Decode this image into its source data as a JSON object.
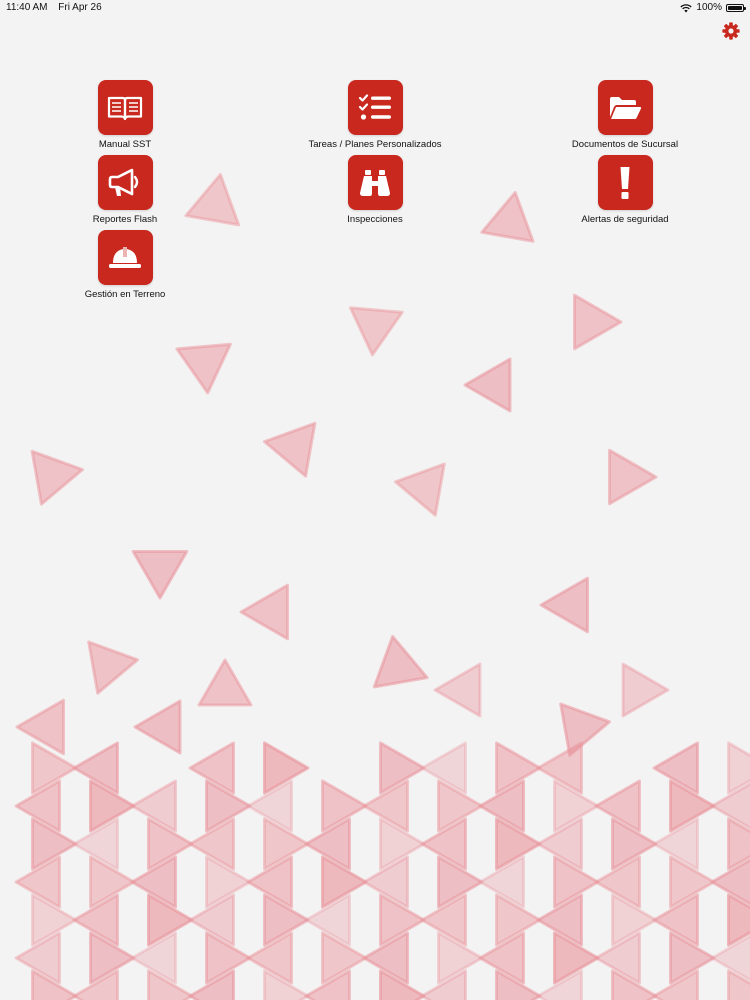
{
  "status_bar": {
    "time": "11:40 AM",
    "date": "Fri Apr 26",
    "battery_text": "100%",
    "battery_level": 1.0,
    "wifi_icon": "wifi-icon",
    "battery_icon": "battery-icon"
  },
  "toolbar": {
    "settings_icon": "gear-icon"
  },
  "colors": {
    "accent": "#c8281e",
    "background": "#f4f3f3",
    "triangle": "#e8929a"
  },
  "menu": {
    "items": [
      {
        "label": "Manual SST",
        "icon": "book-icon"
      },
      {
        "label": "Tareas / Planes Personalizados",
        "icon": "checklist-icon"
      },
      {
        "label": "Documentos de Sucursal",
        "icon": "folder-icon"
      },
      {
        "label": "Reportes Flash",
        "icon": "megaphone-icon"
      },
      {
        "label": "Inspecciones",
        "icon": "binoculars-icon"
      },
      {
        "label": "Alertas de seguridad",
        "icon": "exclamation-icon"
      },
      {
        "label": "Gestión en Terreno",
        "icon": "hard-hat-icon"
      }
    ]
  }
}
